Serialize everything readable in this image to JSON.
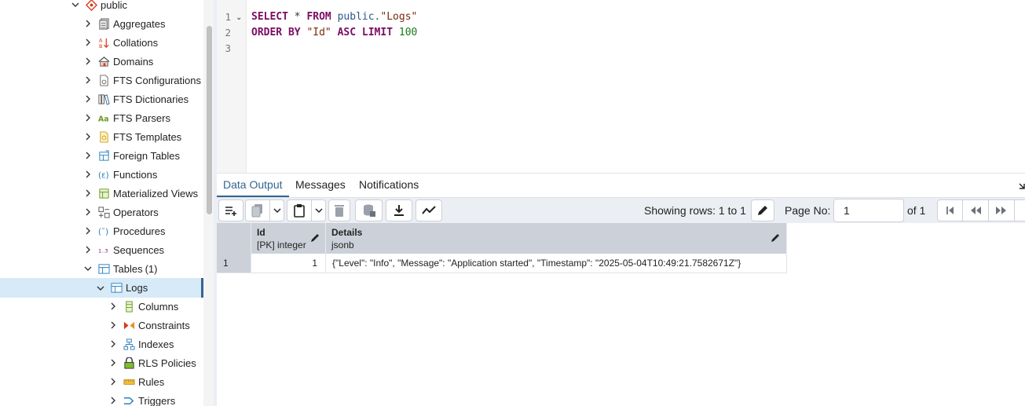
{
  "tree": {
    "schema": "public",
    "items": [
      {
        "label": "Aggregates",
        "icon": "aggregates-icon"
      },
      {
        "label": "Collations",
        "icon": "collations-icon"
      },
      {
        "label": "Domains",
        "icon": "domains-icon"
      },
      {
        "label": "FTS Configurations",
        "icon": "fts-configuration-icon"
      },
      {
        "label": "FTS Dictionaries",
        "icon": "fts-dictionary-icon"
      },
      {
        "label": "FTS Parsers",
        "icon": "fts-parser-icon"
      },
      {
        "label": "FTS Templates",
        "icon": "fts-template-icon"
      },
      {
        "label": "Foreign Tables",
        "icon": "foreign-table-icon"
      },
      {
        "label": "Functions",
        "icon": "function-icon"
      },
      {
        "label": "Materialized Views",
        "icon": "materialized-view-icon"
      },
      {
        "label": "Operators",
        "icon": "operator-icon"
      },
      {
        "label": "Procedures",
        "icon": "procedure-icon"
      },
      {
        "label": "Sequences",
        "icon": "sequence-icon"
      }
    ],
    "tables": {
      "label": "Tables",
      "count": "(1)"
    },
    "selected_table": "Logs",
    "children": [
      {
        "label": "Columns",
        "icon": "columns-icon"
      },
      {
        "label": "Constraints",
        "icon": "constraints-icon"
      },
      {
        "label": "Indexes",
        "icon": "indexes-icon"
      },
      {
        "label": "RLS Policies",
        "icon": "rls-policy-icon"
      },
      {
        "label": "Rules",
        "icon": "rules-icon"
      },
      {
        "label": "Triggers",
        "icon": "triggers-icon"
      }
    ]
  },
  "editor": {
    "line_numbers": [
      "1",
      "2",
      "3"
    ],
    "line1": {
      "kw1": "SELECT",
      "op": " * ",
      "kw2": "FROM",
      "schema": " public.",
      "table": "\"Logs\""
    },
    "line2": {
      "kw1": "ORDER BY",
      "col": " \"Id\" ",
      "kw2": "ASC LIMIT",
      "num": " 100"
    }
  },
  "results": {
    "tabs": [
      "Data Output",
      "Messages",
      "Notifications"
    ],
    "active_tab": "Data Output",
    "showing_rows": "Showing rows: 1 to 1",
    "page_no_label": "Page No:",
    "page_no_value": "1",
    "page_of": "of 1",
    "columns": [
      {
        "name": "Id",
        "type": "[PK] integer"
      },
      {
        "name": "Details",
        "type": "jsonb"
      }
    ],
    "rows": [
      {
        "num": "1",
        "id": "1",
        "details": "{\"Level\": \"Info\", \"Message\": \"Application started\", \"Timestamp\": \"2025-05-04T10:49:21.7582671Z\"}"
      }
    ]
  },
  "colors": {
    "accent": "#326690",
    "selection": "#d6eaf8",
    "header": "#ccd1d9",
    "toolbar": "#ebeef3"
  }
}
